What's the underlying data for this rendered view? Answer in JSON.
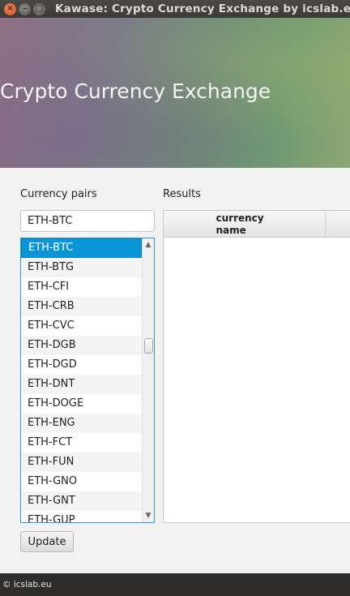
{
  "window": {
    "title": "Kawase: Crypto Currency Exchange by icslab.eu",
    "close_glyph": "×",
    "minimize_glyph": "–",
    "maximize_glyph": "□"
  },
  "banner": {
    "title": "Crypto Currency Exchange"
  },
  "currency_pairs": {
    "label": "Currency pairs",
    "input_value": "ETH-BTC",
    "items": [
      "ETH-BTC",
      "ETH-BTG",
      "ETH-CFI",
      "ETH-CRB",
      "ETH-CVC",
      "ETH-DGB",
      "ETH-DGD",
      "ETH-DNT",
      "ETH-DOGE",
      "ETH-ENG",
      "ETH-FCT",
      "ETH-FUN",
      "ETH-GNO",
      "ETH-GNT",
      "ETH-GUP"
    ],
    "selected_index": 0,
    "scroll_up_glyph": "▲",
    "scroll_down_glyph": "▼"
  },
  "update_button": {
    "label": "Update"
  },
  "results": {
    "label": "Results",
    "columns": [
      "currency name"
    ]
  },
  "footer": {
    "text": "© icslab.eu"
  },
  "colors": {
    "selection": "#0a96d6",
    "list_border": "#2a9ad6",
    "titlebar": "#3b3a36",
    "footer": "#2e2d2b"
  }
}
